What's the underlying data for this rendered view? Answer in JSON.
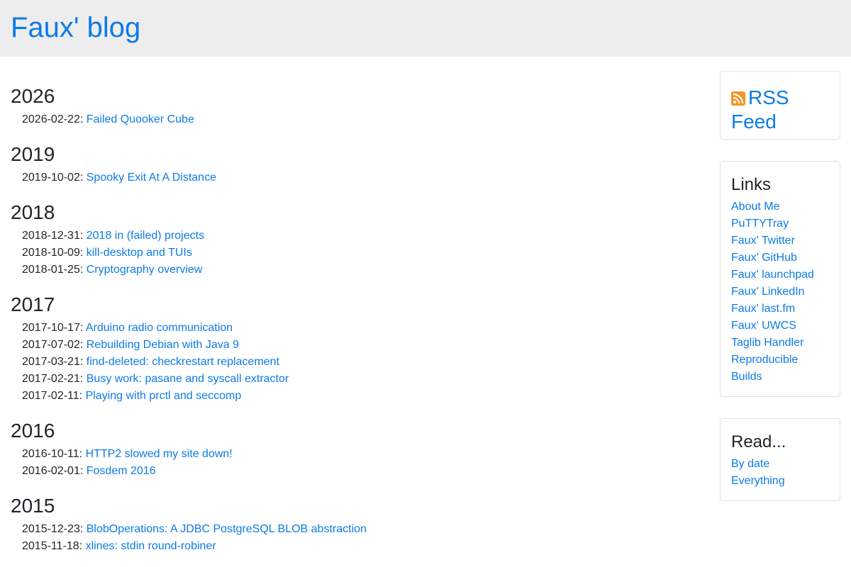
{
  "site": {
    "title": "Faux' blog"
  },
  "archive": [
    {
      "year": "2026",
      "posts": [
        {
          "date": "2026-02-22:",
          "title": "Failed Quooker Cube"
        }
      ]
    },
    {
      "year": "2019",
      "posts": [
        {
          "date": "2019-10-02:",
          "title": "Spooky Exit At A Distance"
        }
      ]
    },
    {
      "year": "2018",
      "posts": [
        {
          "date": "2018-12-31:",
          "title": "2018 in (failed) projects"
        },
        {
          "date": "2018-10-09:",
          "title": "kill-desktop and TUIs"
        },
        {
          "date": "2018-01-25:",
          "title": "Cryptography overview"
        }
      ]
    },
    {
      "year": "2017",
      "posts": [
        {
          "date": "2017-10-17:",
          "title": "Arduino radio communication"
        },
        {
          "date": "2017-07-02:",
          "title": "Rebuilding Debian with Java 9"
        },
        {
          "date": "2017-03-21:",
          "title": "find-deleted: checkrestart replacement"
        },
        {
          "date": "2017-02-21:",
          "title": "Busy work: pasane and syscall extractor"
        },
        {
          "date": "2017-02-11:",
          "title": "Playing with prctl and seccomp"
        }
      ]
    },
    {
      "year": "2016",
      "posts": [
        {
          "date": "2016-10-11:",
          "title": "HTTP2 slowed my site down!"
        },
        {
          "date": "2016-02-01:",
          "title": "Fosdem 2016"
        }
      ]
    },
    {
      "year": "2015",
      "posts": [
        {
          "date": "2015-12-23:",
          "title": "BlobOperations: A JDBC PostgreSQL BLOB abstraction"
        },
        {
          "date": "2015-11-18:",
          "title": "xlines: stdin round-robiner"
        }
      ]
    }
  ],
  "sidebar": {
    "rss": {
      "label": "RSS Feed",
      "icon": "rss-icon",
      "icon_color": "#f7931e"
    },
    "links": {
      "heading": "Links",
      "items": [
        "About Me",
        "PuTTYTray",
        "Faux' Twitter",
        "Faux' GitHub",
        "Faux' launchpad",
        "Faux' LinkedIn",
        "Faux' last.fm",
        "Faux' UWCS",
        "Taglib Handler",
        "Reproducible Builds"
      ]
    },
    "read": {
      "heading": "Read...",
      "items": [
        "By date",
        "Everything"
      ]
    }
  },
  "colors": {
    "link": "#0d7be6",
    "header_bg": "#ededed",
    "text": "#212529"
  }
}
